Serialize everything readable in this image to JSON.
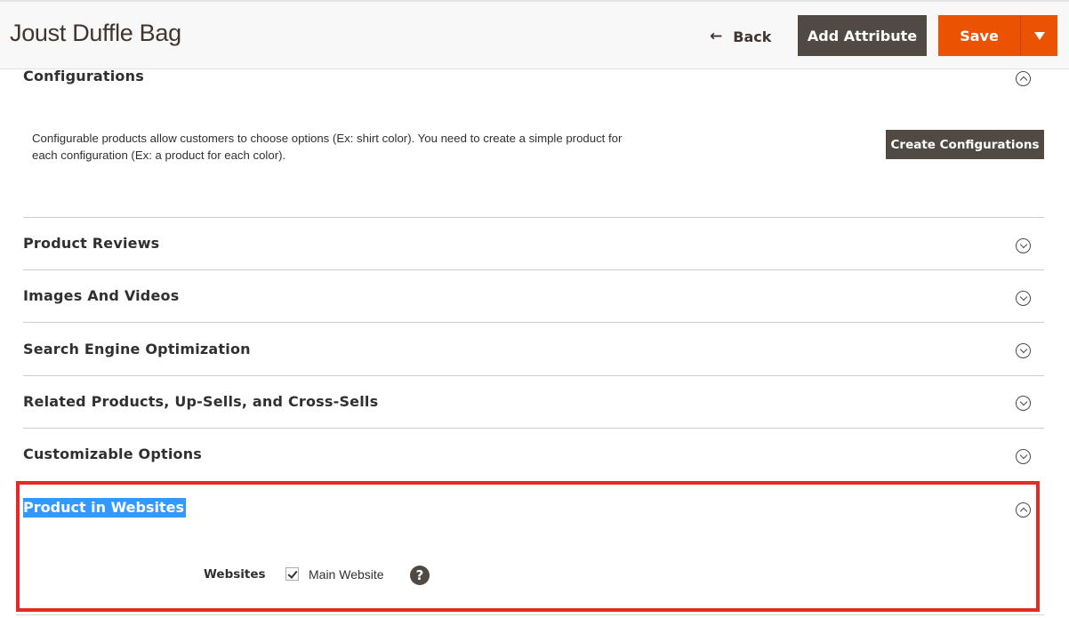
{
  "header": {
    "title": "Joust Duffle Bag",
    "back_label": "Back",
    "back_icon": "arrow-left-icon",
    "add_attribute_label": "Add Attribute",
    "save_label": "Save",
    "save_dropdown_icon": "triangle-down-icon"
  },
  "configurations": {
    "title": "Configurations",
    "expanded": true,
    "description": "Configurable products allow customers to choose options (Ex: shirt color). You need to create a simple product for each configuration (Ex: a product for each color).",
    "create_button_label": "Create Configurations"
  },
  "sections": [
    {
      "title": "Product Reviews",
      "expanded": false
    },
    {
      "title": "Images And Videos",
      "expanded": false
    },
    {
      "title": "Search Engine Optimization",
      "expanded": false
    },
    {
      "title": "Related Products, Up-Sells, and Cross-Sells",
      "expanded": false
    },
    {
      "title": "Customizable Options",
      "expanded": false
    }
  ],
  "product_in_websites": {
    "title": "Product in Websites",
    "expanded": true,
    "field_label": "Websites",
    "option_label": "Main Website",
    "option_checked": true,
    "help_icon_glyph": "?"
  },
  "colors": {
    "primary_action": "#eb5202",
    "secondary_action": "#514943",
    "highlight_border": "#e02b27",
    "text_selection": "#3399ff"
  }
}
